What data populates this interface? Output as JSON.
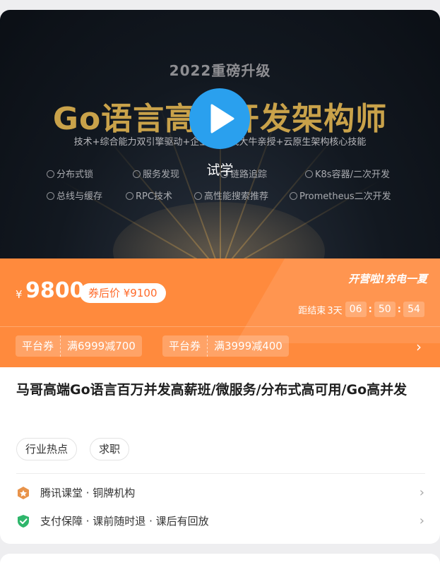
{
  "hero": {
    "subtitle": "2022重磅升级",
    "title": "Go语言高并开发架构师",
    "desc": "技术+综合能力双引擎驱动+企业级    一线大牛亲授+云原生架构核心技能",
    "features": [
      "分布式锁",
      "服务发现",
      "链路追踪",
      "K8s容器/二次开发",
      "总线与缓存",
      "RPC技术",
      "高性能搜索推荐",
      "Prometheus二次开发"
    ],
    "trial_label": "试学"
  },
  "promo": {
    "currency": "¥",
    "price": "9800",
    "after_coupon": "券后价 ¥9100",
    "slogan": "开营啦!充电一夏",
    "countdown": {
      "label": "距结束",
      "days": "3天",
      "hours": "06",
      "minutes": "50",
      "seconds": "54"
    },
    "coupons": [
      {
        "label": "平台券",
        "value": "满6999减700"
      },
      {
        "label": "平台券",
        "value": "满3999减400"
      }
    ],
    "arrow": "›"
  },
  "course": {
    "title": "马哥高端Go语言百万并发高薪班/微服务/分布式高可用/Go高并发",
    "tags": [
      "行业热点",
      "求职"
    ]
  },
  "info": {
    "provider": "腾讯课堂 · 铜牌机构",
    "guarantee": "支付保障 · 课前随时退 · 课后有回放",
    "arrow": "›"
  },
  "colors": {
    "accent_orange": "#ff8a3d",
    "play_blue": "#2aa0ee",
    "gold": "#c9a24a"
  }
}
